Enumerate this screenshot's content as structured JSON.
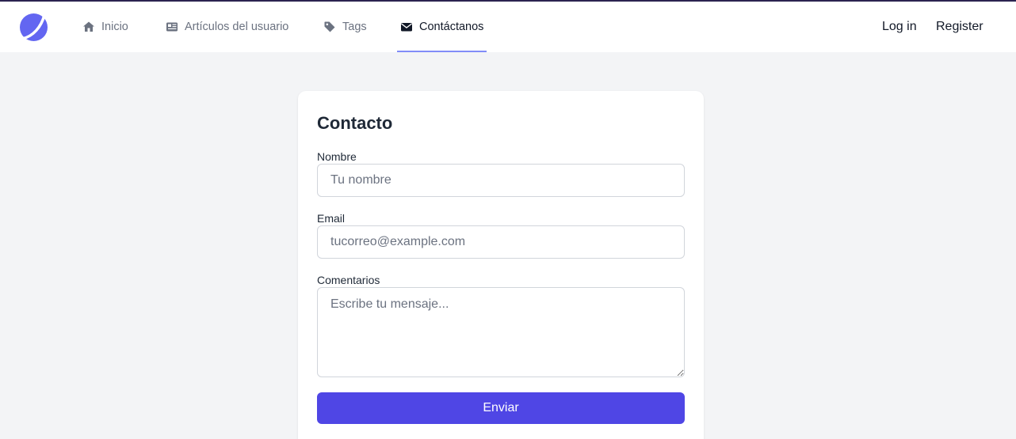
{
  "nav": {
    "items": [
      {
        "label": "Inicio",
        "icon": "home-icon"
      },
      {
        "label": "Artículos del usuario",
        "icon": "newspaper-icon"
      },
      {
        "label": "Tags",
        "icon": "tag-icon"
      },
      {
        "label": "Contáctanos",
        "icon": "envelope-icon"
      }
    ],
    "active": "Contáctanos",
    "login": "Log in",
    "register": "Register"
  },
  "form": {
    "title": "Contacto",
    "name_label": "Nombre",
    "name_placeholder": "Tu nombre",
    "name_value": "",
    "email_label": "Email",
    "email_placeholder": "tucorreo@example.com",
    "email_value": "",
    "comments_label": "Comentarios",
    "comments_placeholder": "Escribe tu mensaje...",
    "comments_value": "",
    "submit_label": "Enviar"
  },
  "colors": {
    "accent": "#4f46e5",
    "logo": "#6366f1",
    "active_underline": "#818cf8",
    "background": "#f3f4f6"
  }
}
